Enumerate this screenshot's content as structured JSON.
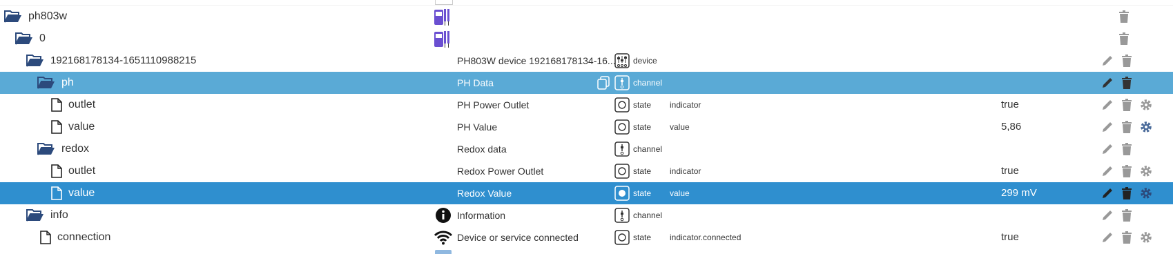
{
  "rows": [
    {
      "label": "ph803w",
      "name": "",
      "role": "",
      "subrole": "",
      "value": ""
    },
    {
      "label": "0",
      "name": "",
      "role": "",
      "subrole": "",
      "value": ""
    },
    {
      "label": "192168178134-1651110988215",
      "name": "PH803W device 192168178134-16...",
      "role": "device",
      "subrole": "",
      "value": ""
    },
    {
      "label": "ph",
      "name": "PH Data",
      "role": "channel",
      "subrole": "",
      "value": ""
    },
    {
      "label": "outlet",
      "name": "PH Power Outlet",
      "role": "state",
      "subrole": "indicator",
      "value": "true"
    },
    {
      "label": "value",
      "name": "PH Value",
      "role": "state",
      "subrole": "value",
      "value": "5,86"
    },
    {
      "label": "redox",
      "name": "Redox data",
      "role": "channel",
      "subrole": "",
      "value": ""
    },
    {
      "label": "outlet",
      "name": "Redox Power Outlet",
      "role": "state",
      "subrole": "indicator",
      "value": "true"
    },
    {
      "label": "value",
      "name": "Redox Value",
      "role": "state",
      "subrole": "value",
      "value": "299 mV"
    },
    {
      "label": "info",
      "name": "Information",
      "role": "channel",
      "subrole": "",
      "value": ""
    },
    {
      "label": "connection",
      "name": "Device or service connected",
      "role": "state",
      "subrole": "indicator.connected",
      "value": "true"
    }
  ],
  "icons": {
    "folder": "folder-open-icon",
    "file": "file-icon",
    "device": "device-icon",
    "channel": "channel-icon",
    "state": "state-icon",
    "edit": "pencil-icon",
    "delete": "trash-icon",
    "settings": "gear-icon",
    "info": "info-icon",
    "wifi": "wifi-icon",
    "copy": "copy-icon"
  },
  "colors": {
    "selected_light": "#5aaad6",
    "selected_dark": "#2f8fcf",
    "folder": "#2c4a7c",
    "gear_blue": "#4a6b9a",
    "device_purple": "#6a4fd1"
  }
}
